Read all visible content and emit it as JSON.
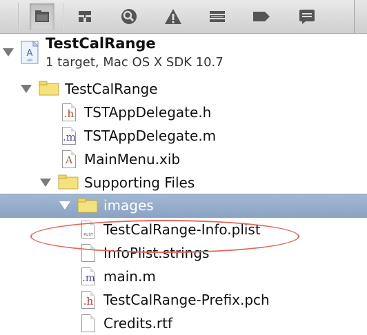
{
  "toolbar": {
    "icons": [
      "project-navigator-icon",
      "symbol-navigator-icon",
      "search-navigator-icon",
      "issue-navigator-icon",
      "debug-navigator-icon",
      "breakpoint-navigator-icon",
      "log-navigator-icon"
    ]
  },
  "project": {
    "name": "TestCalRange",
    "subtitle": "1 target, Mac OS X SDK 10.7"
  },
  "tree": [
    {
      "label": "TestCalRange",
      "kind": "group",
      "expanded": true
    },
    {
      "label": "TSTAppDelegate.h",
      "kind": "h"
    },
    {
      "label": "TSTAppDelegate.m",
      "kind": "m"
    },
    {
      "label": "MainMenu.xib",
      "kind": "xib"
    },
    {
      "label": "Supporting Files",
      "kind": "group",
      "expanded": true
    },
    {
      "label": "images",
      "kind": "group",
      "expanded": true,
      "selected": true
    },
    {
      "label": "TestCalRange-Info.plist",
      "kind": "plist",
      "tag": "PLIST"
    },
    {
      "label": "InfoPlist.strings",
      "kind": "strings"
    },
    {
      "label": "main.m",
      "kind": "m"
    },
    {
      "label": "TestCalRange-Prefix.pch",
      "kind": "h"
    },
    {
      "label": "Credits.rtf",
      "kind": "rtf"
    }
  ],
  "colors": {
    "selection": "#8fa7c7",
    "annotation": "#e06a5e",
    "h_glyph": "#b33a2a",
    "m_glyph": "#5a4a9a"
  }
}
